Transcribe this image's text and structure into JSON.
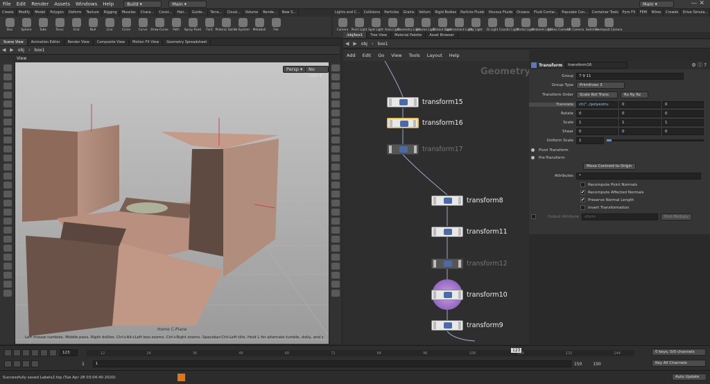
{
  "menubar": {
    "items": [
      "File",
      "Edit",
      "Render",
      "Assets",
      "Windows",
      "Help"
    ],
    "build_label": "Build",
    "desktop_label": "Main",
    "right_desktop_label": "Main"
  },
  "shelf_left": {
    "tabs": [
      "Create",
      "Modify",
      "Model",
      "Polygon",
      "Deform",
      "Texture",
      "Rigging",
      "Muscles",
      "Chara...",
      "Const...",
      "Hair...",
      "Guide...",
      "Terra...",
      "Cloud...",
      "Volume",
      "Rende...",
      "New S..."
    ],
    "tools": [
      "Box",
      "Sphere",
      "Tube",
      "Torus",
      "Grid",
      "Null",
      "Line",
      "Circle",
      "Curve",
      "Draw Curve",
      "Path",
      "Spray Paint",
      "Font",
      "Platonic Solids",
      "L-System",
      "Metaball",
      "File"
    ]
  },
  "shelf_right": {
    "tabs": [
      "Lights and C...",
      "Collisions",
      "Particles",
      "Grains",
      "Vellum",
      "Rigid Bodies",
      "Particle Fluids",
      "Viscous Fluids",
      "Oceans",
      "Fluid Contai...",
      "Populate Con...",
      "Container Tools",
      "Pyro FX",
      "FEM",
      "Wires",
      "Crowds",
      "Drive Simula..."
    ],
    "tools": [
      "Camera",
      "Point Light",
      "Spot Light",
      "Area Light",
      "Geometry Light",
      "Volume Light",
      "Distant Light",
      "Environment Light",
      "Sky Light",
      "GI Light",
      "Caustic Light",
      "Portal Light",
      "Ambient Light",
      "Stereo Camera",
      "VR Camera",
      "Switcher",
      "Gamepad Camera"
    ]
  },
  "left_panel_tabs": [
    "Scene View",
    "Animation Editor",
    "Render View",
    "Composite View",
    "Motion FX View",
    "Geometry Spreadsheet"
  ],
  "right_panel_tabs": [
    "/obj/box1",
    "Tree View",
    "Material Palette",
    "Asset Browser"
  ],
  "path": {
    "obj": "obj",
    "node": "box1"
  },
  "viewport": {
    "title": "View",
    "persp": "Persp",
    "cam": "No cam",
    "hint": "Left mouse tumbles. Middle pans. Right dollies. Ctrl+Alt+Left box-zooms. Ctrl+Right zooms. Spacebar-Ctrl-Left tilts. Hold L for alternate tumble, dolly, and zoom.",
    "plane": "Home C-Plane"
  },
  "network": {
    "menu": [
      "Add",
      "Edit",
      "Go",
      "View",
      "Tools",
      "Layout",
      "Help"
    ],
    "context_label": "Geometry",
    "nodes": [
      {
        "name": "transform15"
      },
      {
        "name": "transform16"
      },
      {
        "name": "transform17"
      },
      {
        "name": "transform8"
      },
      {
        "name": "transform11"
      },
      {
        "name": "transform12"
      },
      {
        "name": "transform10"
      },
      {
        "name": "transform9"
      }
    ]
  },
  "params": {
    "type_label": "Transform",
    "node_name": "transform16",
    "group_label": "Group",
    "group_value": "7 9 11",
    "group_type_label": "Group Type",
    "group_type_value": "Primitives",
    "xform_order_label": "Transform Order",
    "xform_order_value": "Scale Rot Trans",
    "rot_order_value": "Rx Ry Rz",
    "translate_label": "Translate",
    "translate": [
      "ch(\"../polyextru",
      "0",
      "0"
    ],
    "rotate_label": "Rotate",
    "rotate": [
      "0",
      "0",
      "0"
    ],
    "scale_label": "Scale",
    "scale": [
      "1",
      "1",
      "1"
    ],
    "shear_label": "Shear",
    "shear": [
      "0",
      "0",
      "0"
    ],
    "uniform_label": "Uniform Scale",
    "uniform_value": "1",
    "uniform_level": 0.05,
    "pivot_label": "Pivot Transform",
    "pre_label": "Pre-Transform",
    "centroid_button": "Move Centroid to Origin",
    "attributes_label": "Attributes",
    "attributes_value": "*",
    "checks": [
      {
        "label": "Recompute Point Normals",
        "checked": false
      },
      {
        "label": "Recompute Affected Normals",
        "checked": true
      },
      {
        "label": "Preserve Normal Length",
        "checked": true
      },
      {
        "label": "Invert Transformation",
        "checked": false
      }
    ],
    "output_attr_label": "Output Attribute",
    "output_attr_value": "xform",
    "output_mult": "Post Multiply"
  },
  "timeline": {
    "frame": "123",
    "marker": "123",
    "start": "1",
    "start2": "1",
    "end": "150",
    "end2": "150",
    "keys": "0 keys, 0/0 channels",
    "key_all": "Key All Channels",
    "ticks": [
      "12",
      "24",
      "36",
      "48",
      "60",
      "72",
      "84",
      "96",
      "108",
      "120",
      "132",
      "144"
    ]
  },
  "status": {
    "message": "Successfully saved Labels2.hip (Tue Apr 28 03:04:40 2020)",
    "auto_update": "Auto Update"
  }
}
